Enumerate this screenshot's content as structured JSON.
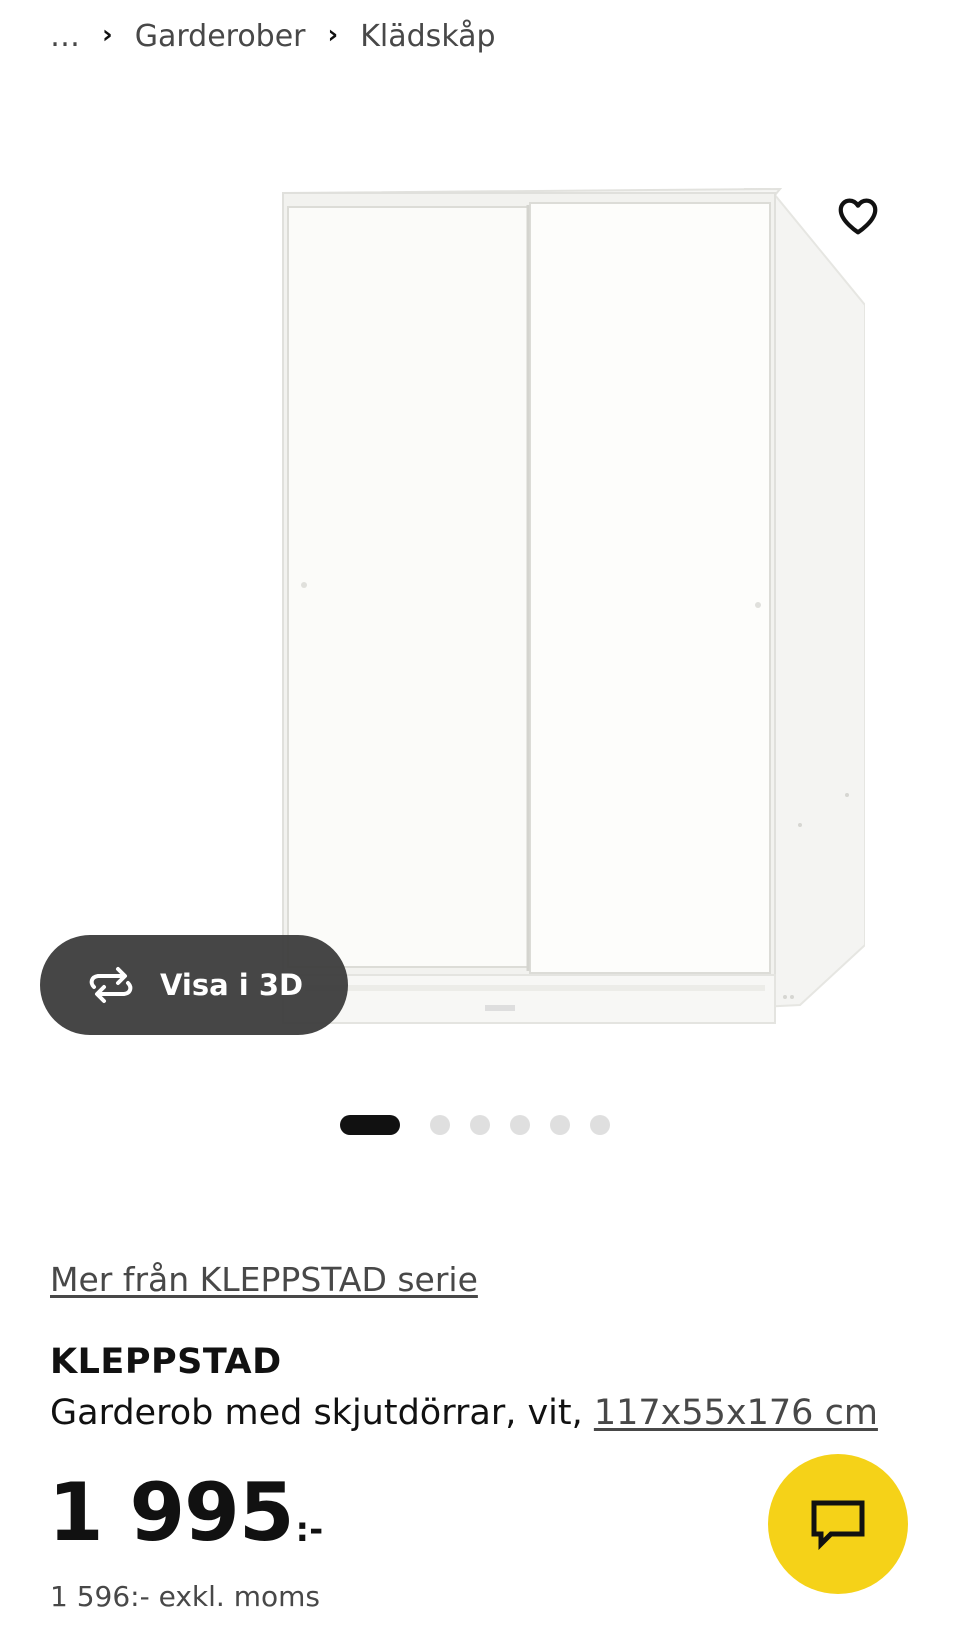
{
  "breadcrumb": {
    "ellipsis": "…",
    "separator": "›",
    "items": [
      {
        "label": "Garderober"
      },
      {
        "label": "Klädskåp"
      }
    ]
  },
  "media": {
    "favorite_icon": "heart-outline-icon",
    "view_3d_label": "Visa i 3D",
    "view_3d_icon": "rotate-arrows-icon",
    "carousel": {
      "count": 6,
      "active_index": 0
    }
  },
  "series_link": "Mer från KLEPPSTAD serie",
  "product": {
    "name": "KLEPPSTAD",
    "description": "Garderob med skjutdörrar, vit, ",
    "dimensions": "117x55x176 cm"
  },
  "price": {
    "amount": "1 995",
    "suffix": ":-",
    "excl_vat": "1 596:- exkl. moms"
  },
  "chat": {
    "icon": "chat-bubble-icon",
    "color": "#f5d218"
  },
  "colors": {
    "text_primary": "#111111",
    "text_secondary": "#484848",
    "overlay_button": "#3c3c3c",
    "accent_yellow": "#f5d218"
  }
}
